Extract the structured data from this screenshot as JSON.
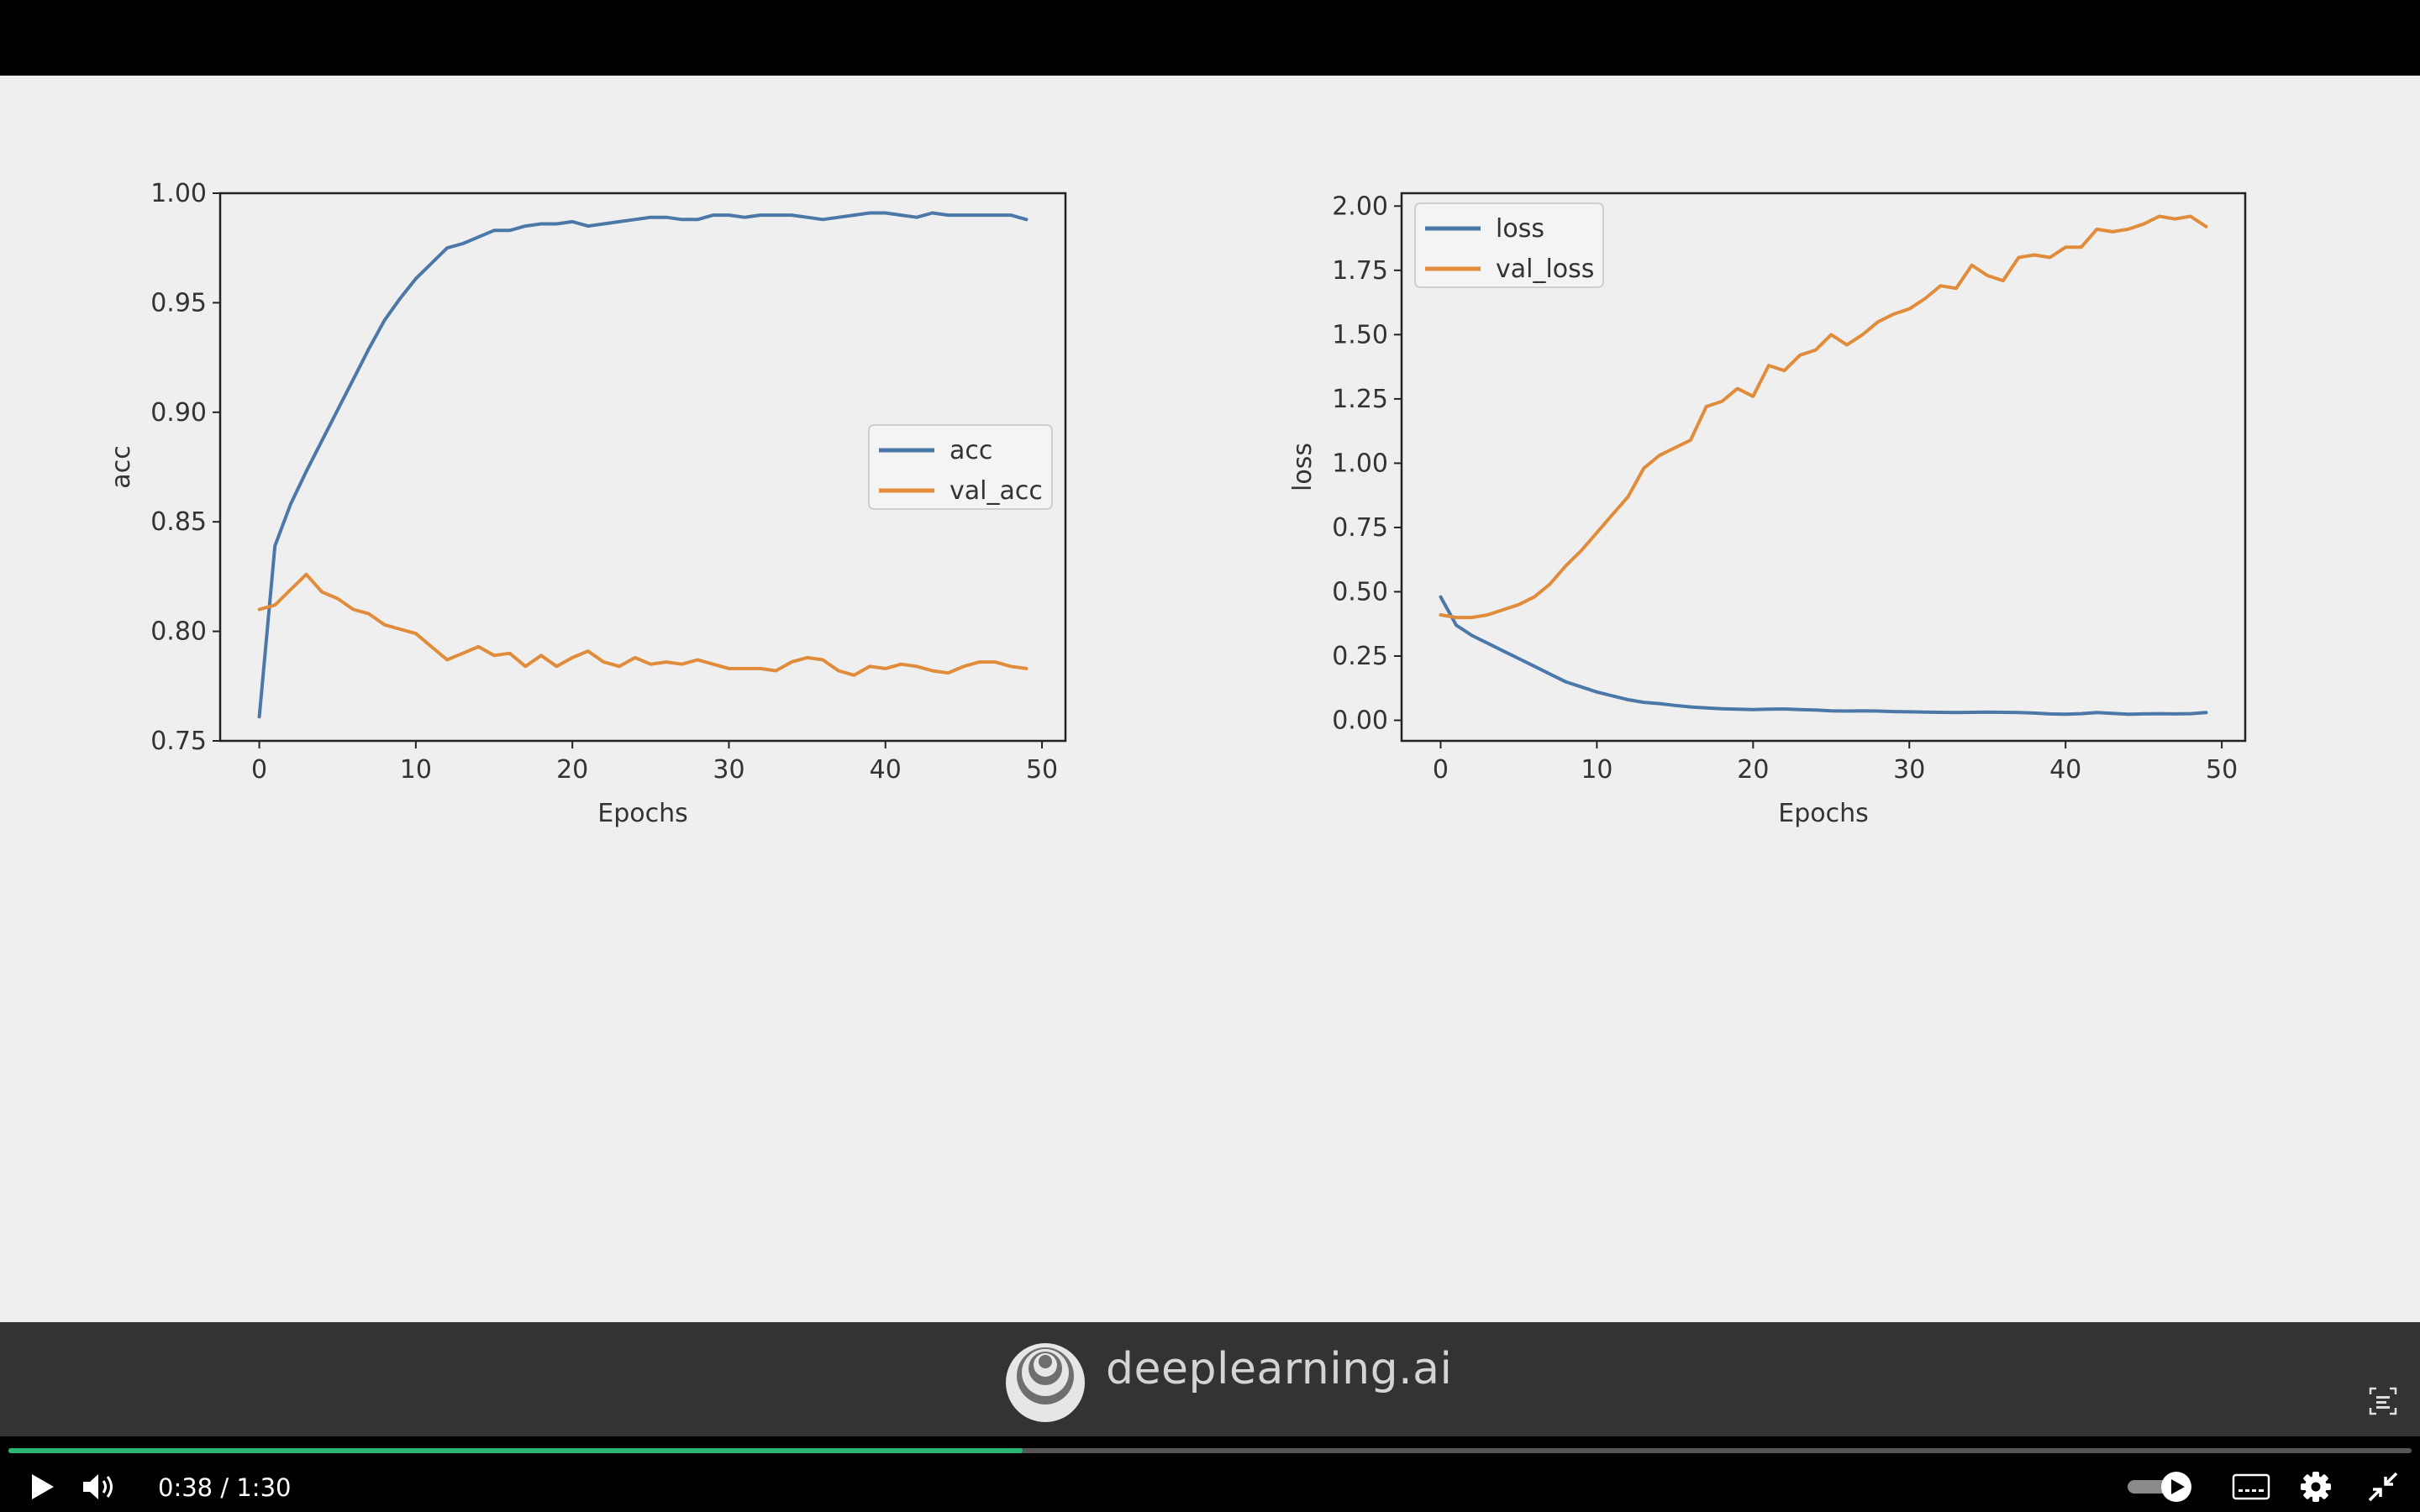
{
  "video": {
    "brand_text": "deeplearning.ai",
    "current_time": "0:38",
    "time_separator": " / ",
    "duration": "1:30",
    "progress_fraction": 0.422,
    "progress_color": "#2bb672"
  },
  "colors": {
    "blue": "#4c78a8",
    "orange": "#e08c3b",
    "slide_bg": "#efefef"
  },
  "icons": [
    "play-icon",
    "volume-icon",
    "speed-toggle-icon",
    "captions-icon",
    "settings-gear-icon",
    "exit-fullscreen-icon",
    "caption-toggle-icon",
    "deeplearning-logo"
  ],
  "chart_data": [
    {
      "type": "line",
      "xlabel": "Epochs",
      "ylabel": "acc",
      "xlim": [
        -2.5,
        51.5
      ],
      "ylim": [
        0.75,
        1.0
      ],
      "xticks": [
        0,
        10,
        20,
        30,
        40,
        50
      ],
      "yticks": [
        0.75,
        0.8,
        0.85,
        0.9,
        0.95,
        1.0
      ],
      "ytick_labels": [
        "0.75",
        "0.80",
        "0.85",
        "0.90",
        "0.95",
        "1.00"
      ],
      "legend_position": "center-right",
      "x": [
        0,
        1,
        2,
        3,
        4,
        5,
        6,
        7,
        8,
        9,
        10,
        11,
        12,
        13,
        14,
        15,
        16,
        17,
        18,
        19,
        20,
        21,
        22,
        23,
        24,
        25,
        26,
        27,
        28,
        29,
        30,
        31,
        32,
        33,
        34,
        35,
        36,
        37,
        38,
        39,
        40,
        41,
        42,
        43,
        44,
        45,
        46,
        47,
        48,
        49
      ],
      "series": [
        {
          "name": "acc",
          "color": "#4c78a8",
          "values": [
            0.761,
            0.839,
            0.858,
            0.873,
            0.887,
            0.901,
            0.915,
            0.929,
            0.942,
            0.952,
            0.961,
            0.968,
            0.975,
            0.977,
            0.98,
            0.983,
            0.983,
            0.985,
            0.986,
            0.986,
            0.987,
            0.985,
            0.986,
            0.987,
            0.988,
            0.989,
            0.989,
            0.988,
            0.988,
            0.99,
            0.99,
            0.989,
            0.99,
            0.99,
            0.99,
            0.989,
            0.988,
            0.989,
            0.99,
            0.991,
            0.991,
            0.99,
            0.989,
            0.991,
            0.99,
            0.99,
            0.99,
            0.99,
            0.99,
            0.988
          ]
        },
        {
          "name": "val_acc",
          "color": "#e08c3b",
          "values": [
            0.81,
            0.812,
            0.819,
            0.826,
            0.818,
            0.815,
            0.81,
            0.808,
            0.803,
            0.801,
            0.799,
            0.793,
            0.787,
            0.79,
            0.793,
            0.789,
            0.79,
            0.784,
            0.789,
            0.784,
            0.788,
            0.791,
            0.786,
            0.784,
            0.788,
            0.785,
            0.786,
            0.785,
            0.787,
            0.785,
            0.783,
            0.783,
            0.783,
            0.782,
            0.786,
            0.788,
            0.787,
            0.782,
            0.78,
            0.784,
            0.783,
            0.785,
            0.784,
            0.782,
            0.781,
            0.784,
            0.786,
            0.786,
            0.784,
            0.783
          ]
        }
      ]
    },
    {
      "type": "line",
      "xlabel": "Epochs",
      "ylabel": "loss",
      "xlim": [
        -2.5,
        51.5
      ],
      "ylim": [
        -0.08,
        2.05
      ],
      "xticks": [
        0,
        10,
        20,
        30,
        40,
        50
      ],
      "yticks": [
        0,
        0.25,
        0.5,
        0.75,
        1.0,
        1.25,
        1.5,
        1.75,
        2.0
      ],
      "ytick_labels": [
        "0.00",
        "0.25",
        "0.50",
        "0.75",
        "1.00",
        "1.25",
        "1.50",
        "1.75",
        "2.00"
      ],
      "legend_position": "upper-left",
      "x": [
        0,
        1,
        2,
        3,
        4,
        5,
        6,
        7,
        8,
        9,
        10,
        11,
        12,
        13,
        14,
        15,
        16,
        17,
        18,
        19,
        20,
        21,
        22,
        23,
        24,
        25,
        26,
        27,
        28,
        29,
        30,
        31,
        32,
        33,
        34,
        35,
        36,
        37,
        38,
        39,
        40,
        41,
        42,
        43,
        44,
        45,
        46,
        47,
        48,
        49
      ],
      "series": [
        {
          "name": "loss",
          "color": "#4c78a8",
          "values": [
            0.48,
            0.37,
            0.33,
            0.3,
            0.27,
            0.24,
            0.21,
            0.18,
            0.15,
            0.13,
            0.11,
            0.095,
            0.08,
            0.07,
            0.065,
            0.058,
            0.052,
            0.048,
            0.045,
            0.043,
            0.042,
            0.043,
            0.044,
            0.042,
            0.04,
            0.037,
            0.036,
            0.037,
            0.036,
            0.034,
            0.033,
            0.032,
            0.031,
            0.03,
            0.031,
            0.032,
            0.031,
            0.03,
            0.028,
            0.025,
            0.024,
            0.026,
            0.03,
            0.027,
            0.024,
            0.025,
            0.026,
            0.025,
            0.026,
            0.03
          ]
        },
        {
          "name": "val_loss",
          "color": "#e08c3b",
          "values": [
            0.41,
            0.4,
            0.4,
            0.41,
            0.43,
            0.45,
            0.48,
            0.53,
            0.6,
            0.66,
            0.73,
            0.8,
            0.87,
            0.98,
            1.03,
            1.06,
            1.09,
            1.22,
            1.24,
            1.29,
            1.26,
            1.38,
            1.36,
            1.42,
            1.44,
            1.5,
            1.46,
            1.5,
            1.55,
            1.58,
            1.6,
            1.64,
            1.69,
            1.68,
            1.77,
            1.73,
            1.71,
            1.8,
            1.81,
            1.8,
            1.84,
            1.84,
            1.91,
            1.9,
            1.91,
            1.93,
            1.96,
            1.95,
            1.96,
            1.92
          ]
        }
      ]
    }
  ]
}
